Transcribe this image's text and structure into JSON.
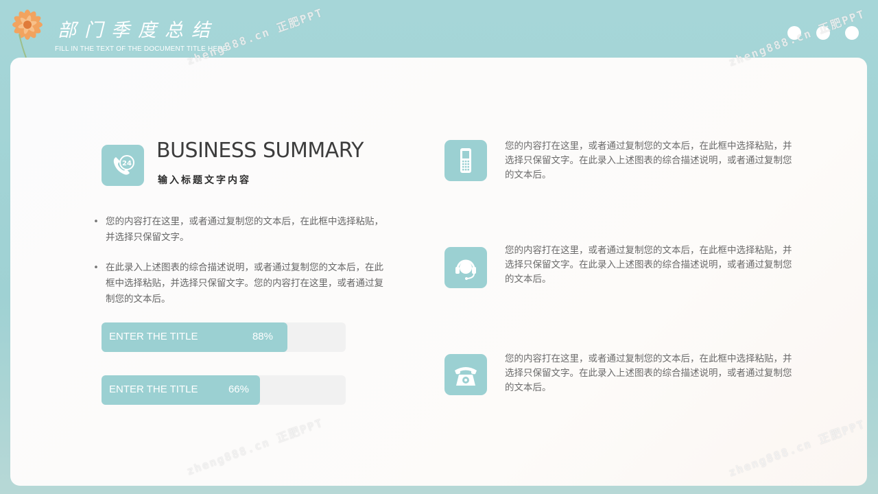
{
  "header": {
    "title": "部门季度总结",
    "subtitle": "FILL IN THE TEXT OF THE DOCUMENT TITLE HERE"
  },
  "watermark": "zheng888.cn 正肥PPT",
  "section": {
    "title": "BUSINESS SUMMARY",
    "subtitle": "输入标题文字内容",
    "icon": "24-hour-phone-icon"
  },
  "bullets": [
    "您的内容打在这里，或者通过复制您的文本后，在此框中选择粘贴，并选择只保留文字。",
    "在此录入上述图表的综合描述说明，或者通过复制您的文本后，在此框中选择粘贴，并选择只保留文字。您的内容打在这里，或者通过复制您的文本后。"
  ],
  "progress": [
    {
      "label": "ENTER THE TITLE",
      "percent_text": "88%",
      "value": 0.76
    },
    {
      "label": "ENTER THE TITLE",
      "percent_text": "66%",
      "value": 0.65
    }
  ],
  "features": [
    {
      "icon": "mobile-phone-icon",
      "text": "您的内容打在这里，或者通过复制您的文本后，在此框中选择粘贴，并选择只保留文字。在此录入上述图表的综合描述说明，或者通过复制您的文本后。"
    },
    {
      "icon": "headset-icon",
      "text": "您的内容打在这里，或者通过复制您的文本后，在此框中选择粘贴，并选择只保留文字。在此录入上述图表的综合描述说明，或者通过复制您的文本后。"
    },
    {
      "icon": "telephone-icon",
      "text": "您的内容打在这里，或者通过复制您的文本后，在此框中选择粘贴，并选择只保留文字。在此录入上述图表的综合描述说明，或者通过复制您的文本后。"
    }
  ],
  "colors": {
    "accent": "#9bd0d2",
    "background": "#a6d6d8",
    "card": "#fbfbfc",
    "text": "#666666",
    "title": "#3d3d3d"
  }
}
